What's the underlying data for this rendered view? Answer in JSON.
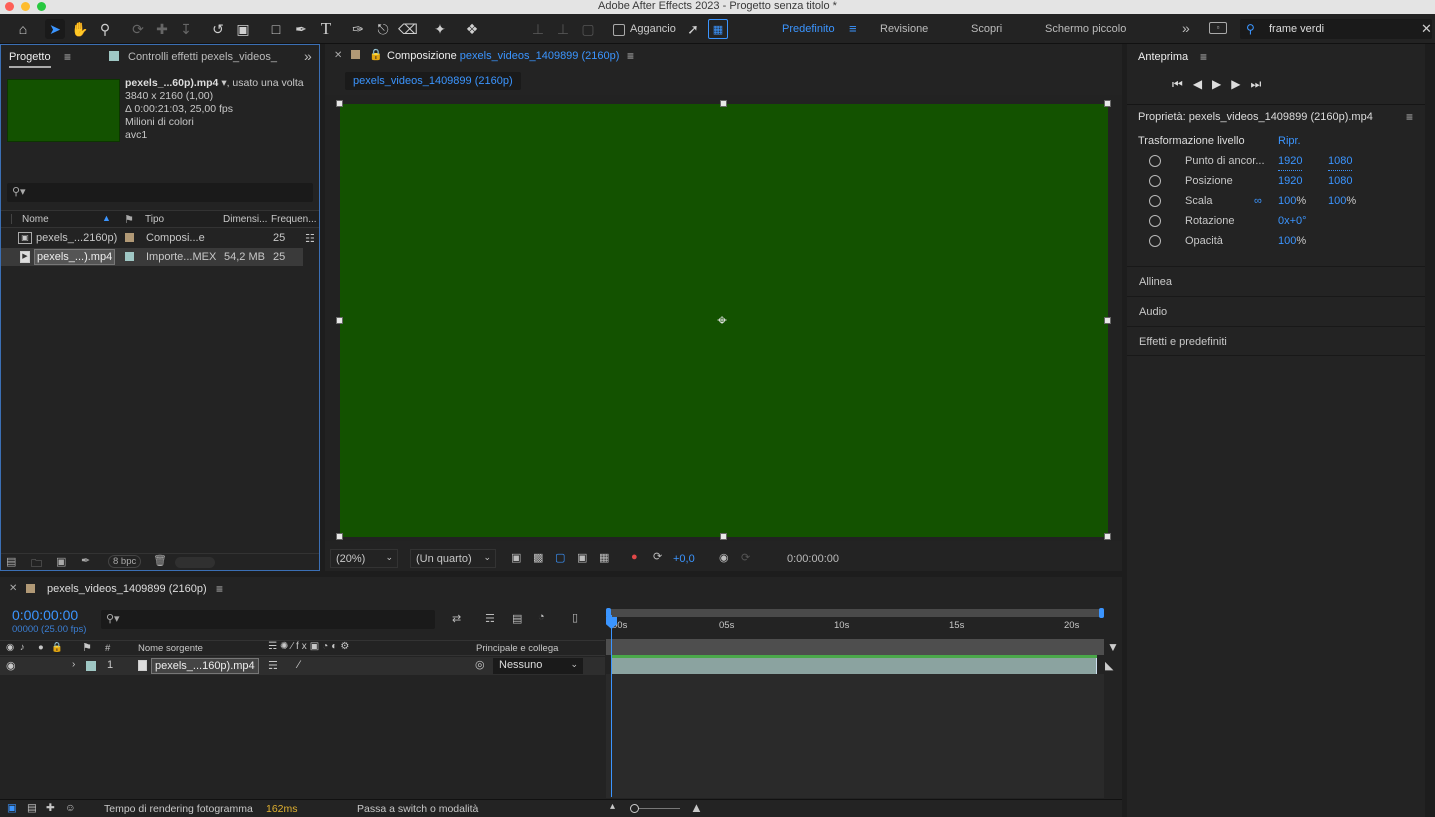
{
  "window": {
    "title": "Adobe After Effects 2023 - Progetto senza titolo *"
  },
  "toolbar": {
    "snapping_label": "Aggancio",
    "workspaces": [
      "Predefinito",
      "Revisione",
      "Scopri",
      "Schermo piccolo"
    ],
    "active_workspace": "Predefinito",
    "search_value": "frame verdi"
  },
  "project_panel": {
    "tab_label": "Progetto",
    "effects_tab_label": "Controlli effetti pexels_videos_",
    "preview_info": {
      "name": "pexels_...60p).mp4",
      "used": ", usato una volta",
      "resolution": "3840 x 2160 (1,00)",
      "duration": "Δ 0:00:21:03, 25,00 fps",
      "colors": "Milioni di colori",
      "codec": "avc1"
    },
    "columns": [
      "Nome",
      "Tipo",
      "Dimensi...",
      "Frequen..."
    ],
    "items": [
      {
        "name": "pexels_...2160p)",
        "type": "Composi...e",
        "size": "",
        "fps": "25",
        "color": "#b19976"
      },
      {
        "name": "pexels_...).mp4",
        "type": "Importe...MEX",
        "size": "54,2 MB",
        "fps": "25",
        "color": "#9fc7c4"
      }
    ],
    "bpc": "8 bpc"
  },
  "composition_panel": {
    "tab_prefix": "Composizione",
    "tab_name": "pexels_videos_1409899 (2160p)",
    "subtab": "pexels_videos_1409899 (2160p)",
    "canvas_color": "#135200",
    "zoom": "(20%)",
    "resolution": "(Un quarto)",
    "exposure": "+0,0",
    "timecode": "0:00:00:00"
  },
  "right_panel": {
    "preview_title": "Anteprima",
    "properties_title": "Proprietà: pexels_videos_1409899 (2160p).mp4",
    "transform_label": "Trasformazione livello",
    "reset_label": "Ripr.",
    "properties": [
      {
        "label": "Punto di ancor...",
        "v1": "1920",
        "v2": "1080"
      },
      {
        "label": "Posizione",
        "v1": "1920",
        "v2": "1080"
      },
      {
        "label": "Scala",
        "v1": "100",
        "u1": "%",
        "v2": "100",
        "u2": "%"
      },
      {
        "label": "Rotazione",
        "v1": "0x+0°",
        "v2": ""
      },
      {
        "label": "Opacità",
        "v1": "100",
        "u1": "%",
        "v2": ""
      }
    ],
    "sections": [
      "Allinea",
      "Audio",
      "Effetti e predefiniti"
    ]
  },
  "timeline": {
    "tab_name": "pexels_videos_1409899 (2160p)",
    "timecode": "0:00:00:00",
    "frame_info": "00000 (25.00 fps)",
    "col_source_name": "Nome sorgente",
    "col_number": "#",
    "col_parent": "Principale e collega",
    "layer": {
      "number": "1",
      "name": "pexels_...160p).mp4",
      "parent": "Nessuno"
    },
    "ruler_labels": [
      "00s",
      "05s",
      "10s",
      "15s",
      "20s"
    ],
    "layer_color": "#9fc7c4"
  },
  "status_bar": {
    "render_label": "Tempo di rendering fotogramma",
    "render_value": "162ms",
    "toggle_label": "Passa a switch o modalità"
  }
}
